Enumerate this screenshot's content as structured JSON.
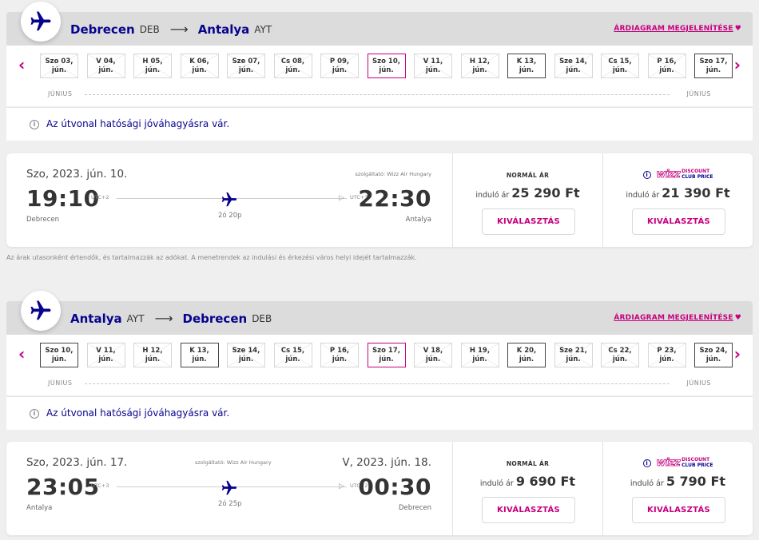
{
  "outbound": {
    "from_city": "Debrecen",
    "from_code": "DEB",
    "arrow": "⟶",
    "to_city": "Antalya",
    "to_code": "AYT",
    "fare_chart_link": "ÁRDIAGRAM MEGJELENÍTÉSE",
    "heart_icon": "♥",
    "prev_arrow": "‹",
    "next_arrow": "›",
    "dates": [
      {
        "day": "Szo 03,",
        "month": "jún.",
        "state": "unavailable"
      },
      {
        "day": "V 04,",
        "month": "jún.",
        "state": "unavailable"
      },
      {
        "day": "H 05,",
        "month": "jún.",
        "state": "unavailable"
      },
      {
        "day": "K 06,",
        "month": "jún.",
        "state": "unavailable"
      },
      {
        "day": "Sze 07,",
        "month": "jún.",
        "state": "unavailable"
      },
      {
        "day": "Cs 08,",
        "month": "jún.",
        "state": "unavailable"
      },
      {
        "day": "P 09,",
        "month": "jún.",
        "state": "unavailable"
      },
      {
        "day": "Szo 10,",
        "month": "jún.",
        "state": "selected"
      },
      {
        "day": "V 11,",
        "month": "jún.",
        "state": "unavailable"
      },
      {
        "day": "H 12,",
        "month": "jún.",
        "state": "unavailable"
      },
      {
        "day": "K 13,",
        "month": "jún.",
        "state": "available"
      },
      {
        "day": "Sze 14,",
        "month": "jún.",
        "state": "unavailable"
      },
      {
        "day": "Cs 15,",
        "month": "jún.",
        "state": "unavailable"
      },
      {
        "day": "P 16,",
        "month": "jún.",
        "state": "unavailable"
      },
      {
        "day": "Szo 17,",
        "month": "jún.",
        "state": "available"
      }
    ],
    "month_left": "JÚNIUS",
    "month_right": "JÚNIUS",
    "notice": "Az útvonal hatósági jóváhagyásra vár.",
    "flight": {
      "date": "Szo, 2023. jún. 10.",
      "arrival_date": "",
      "operator": "szolgáltató: Wizz Air Hungary",
      "dep_time": "19:10",
      "dep_utc": "UTC+2",
      "dep_city": "Debrecen",
      "arr_time": "22:30",
      "arr_utc": "UTC+3",
      "arr_city": "Antalya",
      "duration": "2ó 20p"
    },
    "regular": {
      "title": "NORMÁL ÁR",
      "from": "induló ár",
      "price": "25 290 Ft",
      "button": "KIVÁLASZTÁS"
    },
    "discount": {
      "logo": "wizz",
      "line1": "DISCOUNT",
      "line2": "CLUB PRICE",
      "from": "induló ár",
      "price": "21 390 Ft",
      "button": "KIVÁLASZTÁS"
    }
  },
  "footnote": "Az árak utasonként értendők, és tartalmazzák az adókat. A menetrendek az indulási és érkezési város helyi idejét tartalmazzák.",
  "inbound": {
    "from_city": "Antalya",
    "from_code": "AYT",
    "arrow": "⟶",
    "to_city": "Debrecen",
    "to_code": "DEB",
    "fare_chart_link": "ÁRDIAGRAM MEGJELENÍTÉSE",
    "heart_icon": "♥",
    "prev_arrow": "‹",
    "next_arrow": "›",
    "dates": [
      {
        "day": "Szo 10,",
        "month": "jún.",
        "state": "available"
      },
      {
        "day": "V 11,",
        "month": "jún.",
        "state": "unavailable"
      },
      {
        "day": "H 12,",
        "month": "jún.",
        "state": "unavailable"
      },
      {
        "day": "K 13,",
        "month": "jún.",
        "state": "available"
      },
      {
        "day": "Sze 14,",
        "month": "jún.",
        "state": "unavailable"
      },
      {
        "day": "Cs 15,",
        "month": "jún.",
        "state": "unavailable"
      },
      {
        "day": "P 16,",
        "month": "jún.",
        "state": "unavailable"
      },
      {
        "day": "Szo 17,",
        "month": "jún.",
        "state": "selected"
      },
      {
        "day": "V 18,",
        "month": "jún.",
        "state": "unavailable"
      },
      {
        "day": "H 19,",
        "month": "jún.",
        "state": "unavailable"
      },
      {
        "day": "K 20,",
        "month": "jún.",
        "state": "available"
      },
      {
        "day": "Sze 21,",
        "month": "jún.",
        "state": "unavailable"
      },
      {
        "day": "Cs 22,",
        "month": "jún.",
        "state": "unavailable"
      },
      {
        "day": "P 23,",
        "month": "jún.",
        "state": "unavailable"
      },
      {
        "day": "Szo 24,",
        "month": "jún.",
        "state": "available"
      }
    ],
    "month_left": "JÚNIUS",
    "month_right": "JÚNIUS",
    "notice": "Az útvonal hatósági jóváhagyásra vár.",
    "flight": {
      "date": "Szo, 2023. jún. 17.",
      "arrival_date": "V, 2023. jún. 18.",
      "operator": "szolgáltató: Wizz Air Hungary",
      "dep_time": "23:05",
      "dep_utc": "UTC+3",
      "dep_city": "Antalya",
      "arr_time": "00:30",
      "arr_utc": "UTC+2",
      "arr_city": "Debrecen",
      "duration": "2ó 25p"
    },
    "regular": {
      "title": "NORMÁL ÁR",
      "from": "induló ár",
      "price": "9 690 Ft",
      "button": "KIVÁLASZTÁS"
    },
    "discount": {
      "logo": "wizz",
      "line1": "DISCOUNT",
      "line2": "CLUB PRICE",
      "from": "induló ár",
      "price": "5 790 Ft",
      "button": "KIVÁLASZTÁS"
    }
  },
  "icons": {
    "plane": "plane-icon",
    "info": "info-icon"
  },
  "info_glyph": "i",
  "colors": {
    "navy": "#06038d",
    "magenta": "#c6007e",
    "header_bg": "#dcdcdc",
    "page_bg": "#efefef"
  }
}
